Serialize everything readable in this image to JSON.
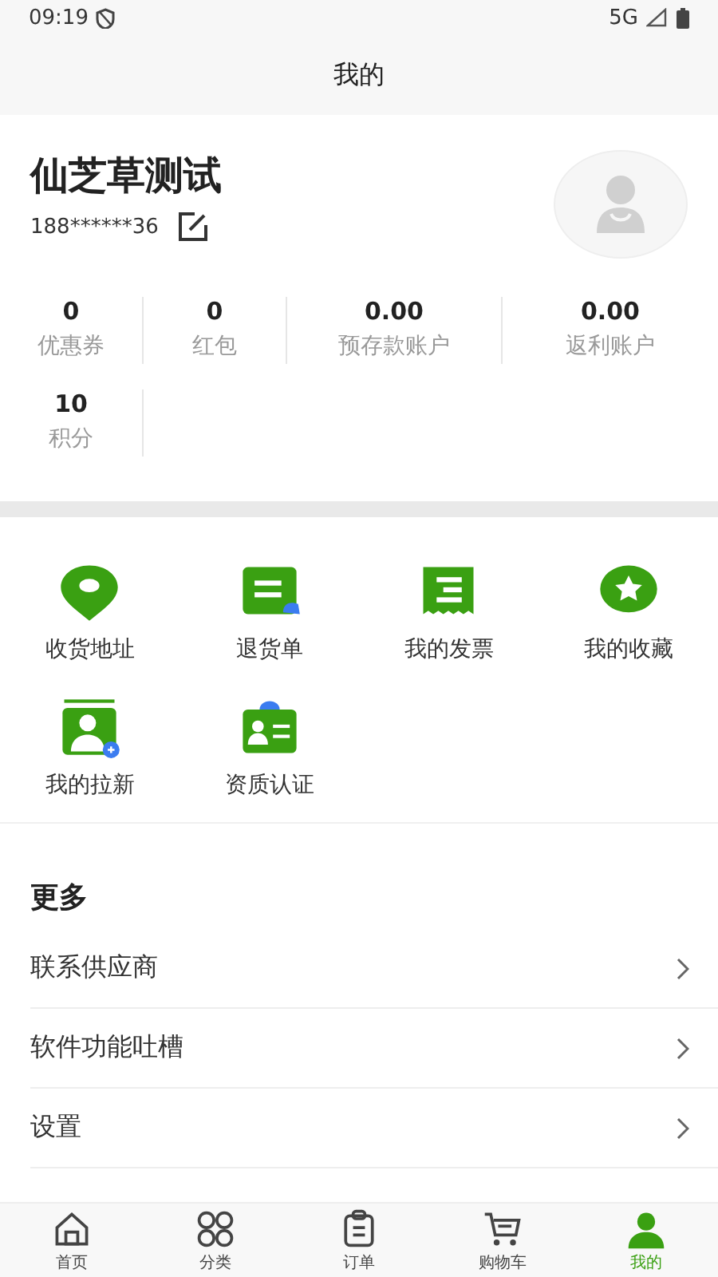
{
  "status_bar": {
    "time": "09:19",
    "network": "5G"
  },
  "header": {
    "title": "我的"
  },
  "profile": {
    "name": "仙芝草测试",
    "phone": "188******36"
  },
  "stats": [
    {
      "value": "0",
      "label": "优惠券"
    },
    {
      "value": "0",
      "label": "红包"
    },
    {
      "value": "0.00",
      "label": "预存款账户"
    },
    {
      "value": "0.00",
      "label": "返利账户"
    },
    {
      "value": "10",
      "label": "积分"
    }
  ],
  "services": [
    {
      "label": "收货地址"
    },
    {
      "label": "退货单"
    },
    {
      "label": "我的发票"
    },
    {
      "label": "我的收藏"
    },
    {
      "label": "我的拉新"
    },
    {
      "label": "资质认证"
    }
  ],
  "more": {
    "title": "更多",
    "items": [
      {
        "label": "联系供应商"
      },
      {
        "label": "软件功能吐槽"
      },
      {
        "label": "设置"
      }
    ]
  },
  "tab_bar": [
    {
      "label": "首页",
      "selected": false
    },
    {
      "label": "分类",
      "selected": false
    },
    {
      "label": "订单",
      "selected": false
    },
    {
      "label": "购物车",
      "selected": false
    },
    {
      "label": "我的",
      "selected": true
    }
  ]
}
